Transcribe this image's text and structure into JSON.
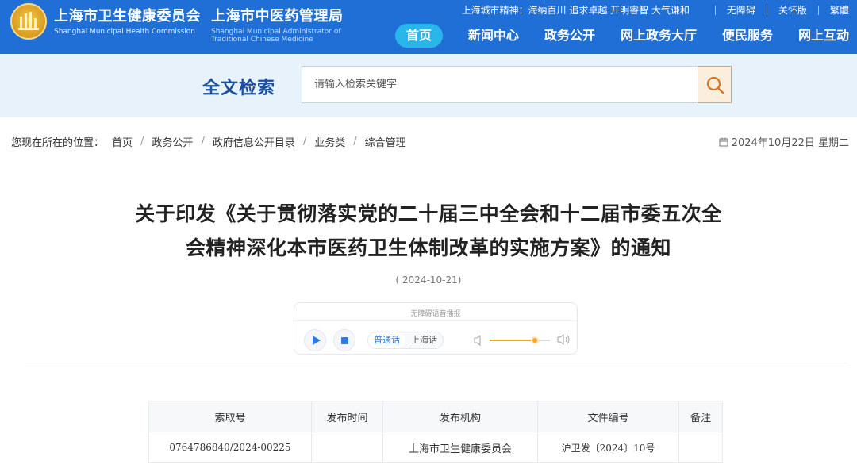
{
  "header": {
    "org1_cn": "上海市卫生健康委员会",
    "org1_en": "Shanghai Municipal Health Commission",
    "org2_cn": "上海市中医药管理局",
    "org2_en": "Shanghai Municipal Administrator of Traditional Chinese Medicine",
    "city_spirit": "上海城市精神：海纳百川 追求卓越 开明睿智 大气谦和",
    "utility_links": [
      "无障碍",
      "关怀版",
      "繁體"
    ],
    "nav": [
      "首页",
      "新闻中心",
      "政务公开",
      "网上政务大厅",
      "便民服务",
      "网上互动"
    ],
    "active_nav": "首页"
  },
  "search": {
    "title": "全文检索",
    "placeholder": "请输入检索关键字",
    "button_icon": "search-icon"
  },
  "breadcrumb": {
    "label": "您现在所在的位置：",
    "items": [
      "首页",
      "政务公开",
      "政府信息公开目录",
      "业务类",
      "综合管理"
    ]
  },
  "today": "2024年10月22日 星期二",
  "article": {
    "title_line1": "关于印发《关于贯彻落实党的二十届三中全会和十二届市委五次全",
    "title_line2": "会精神深化本市医药卫生体制改革的实施方案》的通知",
    "date": "( 2024-10-21)"
  },
  "player": {
    "label": "无障碍语音播报",
    "lang_options": [
      "普通话",
      "上海话"
    ],
    "selected_lang": "普通话",
    "volume": 0.75
  },
  "info_table": {
    "headers": [
      "索取号",
      "发布时间",
      "发布机构",
      "文件编号",
      "备注"
    ],
    "row": [
      "0764786840/2024-00225",
      "",
      "上海市卫生健康委员会",
      "沪卫发〔2024〕10号",
      ""
    ]
  },
  "colors": {
    "header_bg": "#1f6fd6",
    "active_nav_bg": "#29b6e8",
    "search_band_bg": "#e8f2fb",
    "search_title": "#1a4fa0",
    "accent_orange": "#f5a623"
  }
}
